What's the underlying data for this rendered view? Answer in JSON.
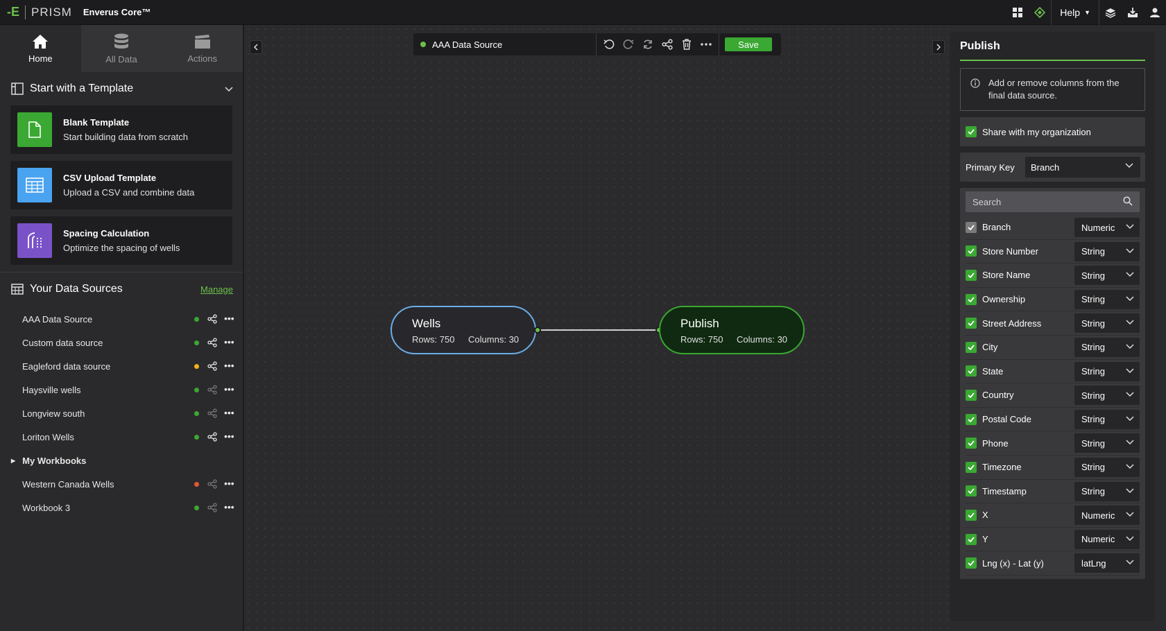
{
  "topbar": {
    "logo_mark": "-E",
    "product": "PRISM",
    "app_name": "Enverus Core™",
    "help_label": "Help"
  },
  "left": {
    "tabs": [
      {
        "label": "Home",
        "icon": "home-icon",
        "active": true
      },
      {
        "label": "All Data",
        "icon": "database-icon",
        "active": false
      },
      {
        "label": "Actions",
        "icon": "clapperboard-icon",
        "active": false
      }
    ],
    "templates_title": "Start with a Template",
    "templates": [
      {
        "title": "Blank Template",
        "desc": "Start building data from scratch",
        "icon": "file-icon",
        "color": "#3aa832"
      },
      {
        "title": "CSV Upload Template",
        "desc": "Upload a CSV and combine data",
        "icon": "table-icon",
        "color": "#4aa3f0"
      },
      {
        "title": "Spacing Calculation",
        "desc": "Optimize the spacing of wells",
        "icon": "spacing-icon",
        "color": "#7a52c8"
      }
    ],
    "data_sources_title": "Your Data Sources",
    "manage_label": "Manage",
    "data_sources": [
      {
        "name": "AAA Data Source",
        "status": "#3aa832",
        "shared": true
      },
      {
        "name": "Custom data source",
        "status": "#3aa832",
        "shared": true
      },
      {
        "name": "Eagleford data source",
        "status": "#f2b01e",
        "shared": true
      },
      {
        "name": "Haysville wells",
        "status": "#3aa832",
        "shared": false
      },
      {
        "name": "Longview south",
        "status": "#3aa832",
        "shared": false
      },
      {
        "name": "Loriton Wells",
        "status": "#3aa832",
        "shared": true
      }
    ],
    "folder_label": "My Workbooks",
    "workbooks": [
      {
        "name": "Western Canada Wells",
        "status": "#e8552c",
        "shared": false
      },
      {
        "name": "Workbook 3",
        "status": "#3aa832",
        "shared": false
      }
    ]
  },
  "toolbar": {
    "source_name": "AAA Data Source",
    "save_label": "Save"
  },
  "canvas": {
    "wells": {
      "title": "Wells",
      "rows": "Rows: 750",
      "columns": "Columns: 30"
    },
    "publish": {
      "title": "Publish",
      "rows": "Rows: 750",
      "columns": "Columns: 30"
    }
  },
  "right": {
    "title": "Publish",
    "info_text": "Add or remove columns from the final data source.",
    "share_label": "Share with my organization",
    "primary_key_label": "Primary Key",
    "primary_key_value": "Branch",
    "search_placeholder": "Search",
    "columns": [
      {
        "name": "Branch",
        "type": "Numeric",
        "disabled": true
      },
      {
        "name": "Store Number",
        "type": "String",
        "disabled": false
      },
      {
        "name": "Store Name",
        "type": "String",
        "disabled": false
      },
      {
        "name": "Ownership",
        "type": "String",
        "disabled": false
      },
      {
        "name": "Street Address",
        "type": "String",
        "disabled": false
      },
      {
        "name": "City",
        "type": "String",
        "disabled": false
      },
      {
        "name": "State",
        "type": "String",
        "disabled": false
      },
      {
        "name": "Country",
        "type": "String",
        "disabled": false
      },
      {
        "name": "Postal Code",
        "type": "String",
        "disabled": false
      },
      {
        "name": "Phone",
        "type": "String",
        "disabled": false
      },
      {
        "name": "Timezone",
        "type": "String",
        "disabled": false
      },
      {
        "name": "Timestamp",
        "type": "String",
        "disabled": false
      },
      {
        "name": "X",
        "type": "Numeric",
        "disabled": false
      },
      {
        "name": "Y",
        "type": "Numeric",
        "disabled": false
      },
      {
        "name": "Lng (x) - Lat (y)",
        "type": "latLng",
        "disabled": false
      }
    ]
  },
  "colors": {
    "accent": "#3aa832",
    "node_blue": "#6aaee8",
    "topbar": "#1c1c1e"
  }
}
